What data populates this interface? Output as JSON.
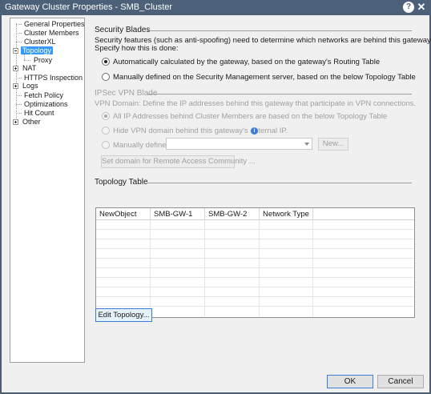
{
  "window": {
    "title": "Gateway Cluster Properties - SMB_Cluster",
    "help_glyph": "?",
    "close_glyph": "✕"
  },
  "tree": {
    "items": [
      {
        "label": "General Properties",
        "expander": null,
        "selected": false
      },
      {
        "label": "Cluster Members",
        "expander": null,
        "selected": false
      },
      {
        "label": "ClusterXL",
        "expander": null,
        "selected": false
      },
      {
        "label": "Topology",
        "expander": "minus",
        "selected": true
      },
      {
        "label": "Proxy",
        "expander": null,
        "selected": false
      },
      {
        "label": "NAT",
        "expander": "plus",
        "selected": false
      },
      {
        "label": "HTTPS Inspection",
        "expander": null,
        "selected": false
      },
      {
        "label": "Logs",
        "expander": "plus",
        "selected": false
      },
      {
        "label": "Fetch Policy",
        "expander": null,
        "selected": false
      },
      {
        "label": "Optimizations",
        "expander": null,
        "selected": false
      },
      {
        "label": "Hit Count",
        "expander": null,
        "selected": false
      },
      {
        "label": "Other",
        "expander": "plus",
        "selected": false
      }
    ]
  },
  "security_blades": {
    "title": "Security Blades",
    "description_line1": "Security features (such as anti-spoofing) need to determine which networks are behind this gateway.",
    "description_line2": "Specify how this is done:",
    "option_auto": "Automatically calculated by the gateway, based on the gateway's Routing Table",
    "option_manual": "Manually defined on the Security Management server, based on the below Topology Table"
  },
  "vpn_blade": {
    "title": "IPSec VPN Blade",
    "description": "VPN Domain: Define the IP addresses behind this gateway that participate in VPN connections.",
    "option_all_ip": "All IP Addresses behind Cluster Members are based on the below Topology Table",
    "option_hide": "Hide VPN domain behind this gateway's external IP.",
    "option_manual": "Manually defined:",
    "manual_value": "",
    "new_button": "New...",
    "set_domain_button": "Set domain for Remote Access Community ..."
  },
  "topology_table": {
    "title": "Topology Table",
    "columns": [
      "NewObject",
      "SMB-GW-1",
      "SMB-GW-2",
      "Network Type",
      ""
    ],
    "rows": []
  },
  "edit_topology_button": "Edit Topology...",
  "footer": {
    "ok": "OK",
    "cancel": "Cancel"
  }
}
